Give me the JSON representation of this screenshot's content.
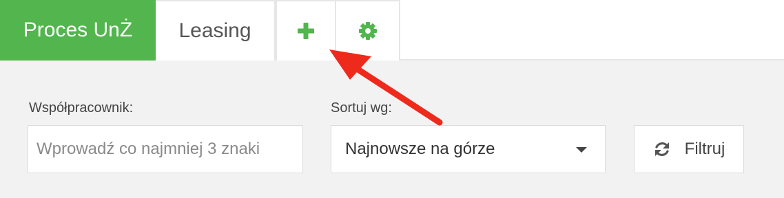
{
  "tabs": {
    "active_label": "Proces UnŻ",
    "second_label": "Leasing",
    "add_icon": "plus-icon",
    "settings_icon": "gear-icon"
  },
  "filters": {
    "coworker_label": "Współpracownik:",
    "coworker_placeholder": "Wprowadź co najmniej 3 znaki",
    "sort_label": "Sortuj wg:",
    "sort_value": "Najnowsze na górze",
    "filter_button": "Filtruj",
    "filter_icon": "refresh-icon"
  },
  "colors": {
    "accent": "#52b54d",
    "annotation_arrow": "#ee2a1c"
  }
}
